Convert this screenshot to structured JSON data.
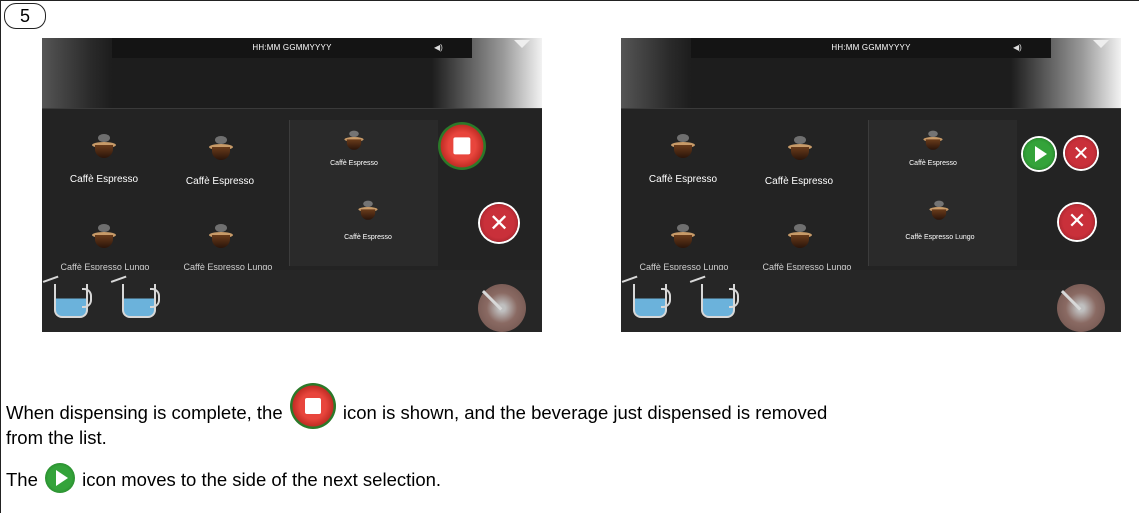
{
  "step": {
    "number": "5"
  },
  "screens": [
    {
      "header": {
        "time": "HH:MM GGMMYYYY",
        "volume_icon": "speaker-icon",
        "menu_icon": "chevron-down-icon"
      },
      "beverages": {
        "left_top": [
          "Caffè Espresso",
          "Caffè Espresso"
        ],
        "left_bottom_cut": [
          "Caffè Espresso Lungo",
          "Caffè Espresso Lungo"
        ],
        "right": [
          "Caffè Espresso",
          "Caffè Espresso"
        ]
      },
      "buttons": [
        "stop-icon",
        "cancel-icon"
      ]
    },
    {
      "header": {
        "time": "HH:MM GGMMYYYY",
        "volume_icon": "speaker-icon",
        "menu_icon": "chevron-down-icon"
      },
      "beverages": {
        "left_top": [
          "Caffè Espresso",
          "Caffè Espresso"
        ],
        "left_bottom_cut": [
          "Caffè Espresso Lungo",
          "Caffè Espresso Lungo"
        ],
        "right": [
          "Caffè Espresso",
          "Caffè Espresso Lungo"
        ]
      },
      "buttons": [
        "play-icon",
        "cancel-icon",
        "cancel-icon"
      ]
    }
  ],
  "text": {
    "line1_a": "When dispensing is complete, the",
    "line1_b": "icon is shown, and the beverage just dispensed is removed",
    "line2": "from the list.",
    "line3_a": "The",
    "line3_b": "icon moves to the side of the next selection."
  },
  "colors": {
    "stop_red": "#e8453c",
    "ring_green": "#2c7a2a",
    "play_green": "#34a33a",
    "cancel_red": "#c9303a",
    "water_blue": "#6bb2db"
  }
}
